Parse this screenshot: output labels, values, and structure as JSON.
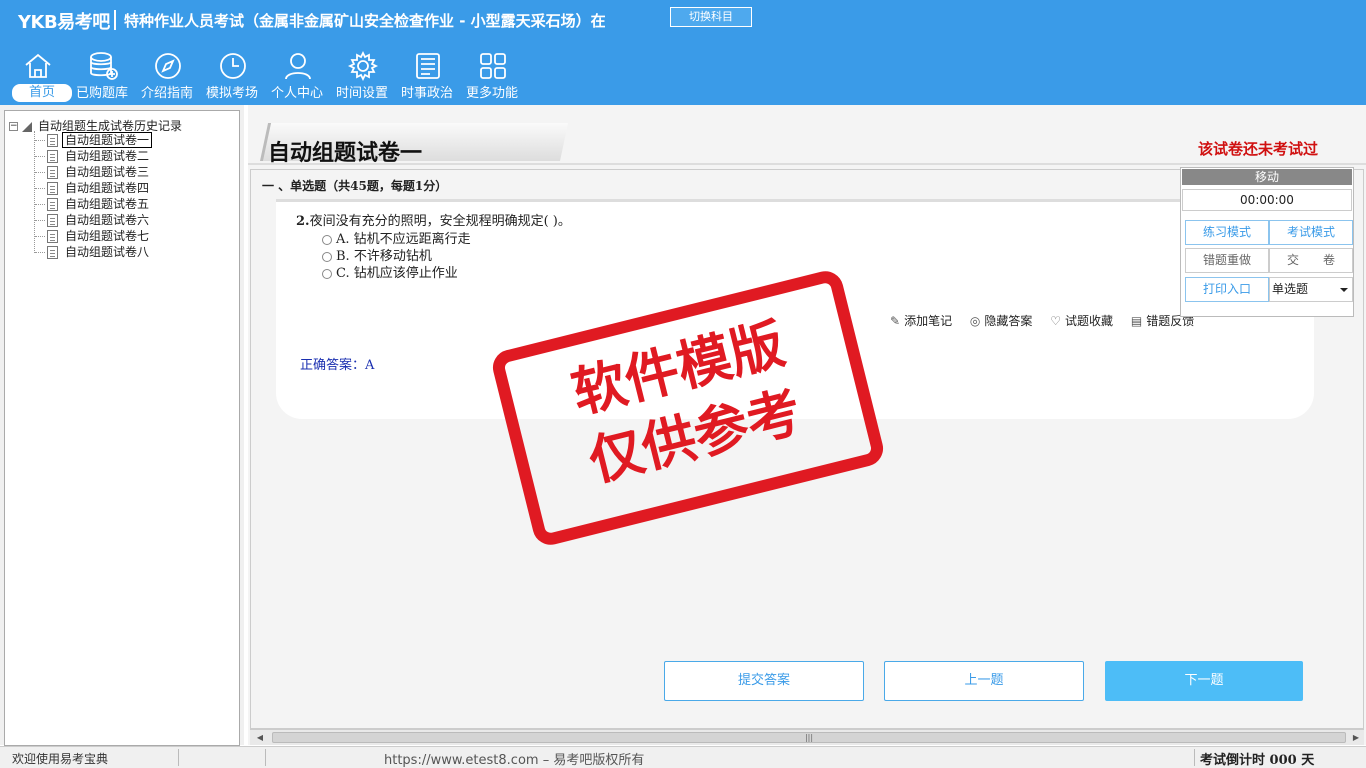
{
  "header": {
    "brand": "YKB易考吧",
    "title": "特种作业人员考试（金属非金属矿山安全检查作业 - 小型露天采石场）在",
    "switch_subject": "切换科目"
  },
  "nav": [
    {
      "label": "首页",
      "icon": "home-icon"
    },
    {
      "label": "已购题库",
      "icon": "database-icon"
    },
    {
      "label": "介绍指南",
      "icon": "compass-icon"
    },
    {
      "label": "模拟考场",
      "icon": "clock-icon"
    },
    {
      "label": "个人中心",
      "icon": "user-icon"
    },
    {
      "label": "时间设置",
      "icon": "gear-icon"
    },
    {
      "label": "时事政治",
      "icon": "newspaper-icon"
    },
    {
      "label": "更多功能",
      "icon": "grid-icon"
    }
  ],
  "tree": {
    "root": "自动组题生成试卷历史记录",
    "items": [
      "自动组题试卷一",
      "自动组题试卷二",
      "自动组题试卷三",
      "自动组题试卷四",
      "自动组题试卷五",
      "自动组题试卷六",
      "自动组题试卷七",
      "自动组题试卷八"
    ]
  },
  "paper": {
    "title": "自动组题试卷一",
    "status": "该试卷还未考试过",
    "section": "一 、单选题（共45题，每题1分）"
  },
  "question": {
    "number": "2.",
    "text": "夜间没有充分的照明，安全规程明确规定( )。",
    "options": [
      "A. 钻机不应远距离行走",
      "B. 不许移动钻机",
      "C. 钻机应该停止作业"
    ],
    "answer": "正确答案：A"
  },
  "tools": [
    "添加笔记",
    "隐藏答案",
    "试题收藏",
    "错题反馈"
  ],
  "buttons": {
    "submit": "提交答案",
    "prev": "上一题",
    "next": "下一题"
  },
  "right_panel": {
    "move": "移动",
    "timer": "00:00:00",
    "practice_mode": "练习模式",
    "exam_mode": "考试模式",
    "redo_wrong": "错题重做",
    "hand_in": "交　　卷",
    "print": "打印入口",
    "type_select": "单选题"
  },
  "watermark": {
    "line1": "软件模版",
    "line2": "仅供参考"
  },
  "status_bar": {
    "welcome": "欢迎使用易考宝典",
    "copyright": "https://www.etest8.com – 易考吧版权所有",
    "countdown": "考试倒计时 000 天"
  },
  "colors": {
    "header_bg": "#3a9be8",
    "status_red": "#d01010",
    "answer_blue": "#1a2fb0",
    "next_btn": "#4dbdf7"
  }
}
